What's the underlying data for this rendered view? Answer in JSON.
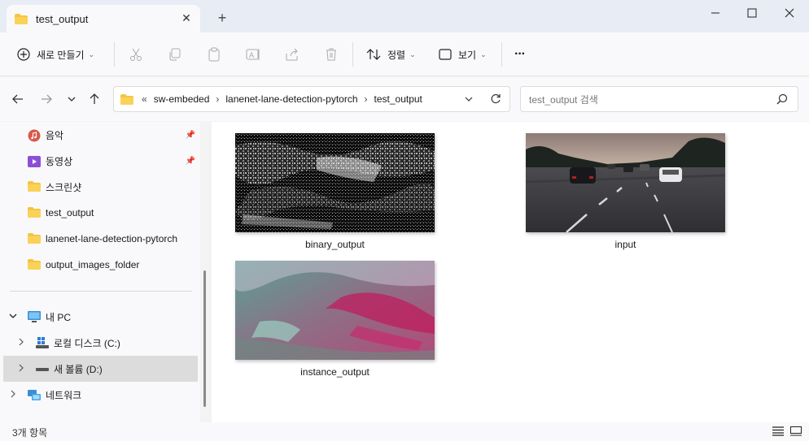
{
  "window": {
    "tab_title": "test_output",
    "tab_close": "✕",
    "new_tab": "+",
    "minimize": "—",
    "maximize": "☐",
    "close": "✕"
  },
  "toolbar": {
    "new_label": "새로 만들기",
    "sort_label": "정렬",
    "view_label": "보기",
    "more_label": "···"
  },
  "address": {
    "overflow": "«",
    "crumbs": [
      "sw-embeded",
      "lanenet-lane-detection-pytorch",
      "test_output"
    ],
    "separator": "›"
  },
  "search": {
    "placeholder": "test_output 검색"
  },
  "sidebar": {
    "items": [
      {
        "label": "음악",
        "icon": "music-icon"
      },
      {
        "label": "동영상",
        "icon": "video-icon"
      },
      {
        "label": "스크린샷",
        "icon": "folder-icon"
      },
      {
        "label": "test_output",
        "icon": "folder-icon"
      },
      {
        "label": "lanenet-lane-detection-pytorch",
        "icon": "folder-icon"
      },
      {
        "label": "output_images_folder",
        "icon": "folder-icon"
      }
    ],
    "pc": {
      "label": "내 PC"
    },
    "drives": [
      {
        "label": "로컬 디스크 (C:)"
      },
      {
        "label": "새 볼륨 (D:)"
      }
    ],
    "network": {
      "label": "네트워크"
    }
  },
  "files": [
    {
      "name": "binary_output"
    },
    {
      "name": "input"
    },
    {
      "name": "instance_output"
    }
  ],
  "status": {
    "item_count": "3개 항목"
  },
  "colors": {
    "folder": "#f4c542",
    "accent": "#0067c0",
    "selected": "#dcdcdc"
  }
}
